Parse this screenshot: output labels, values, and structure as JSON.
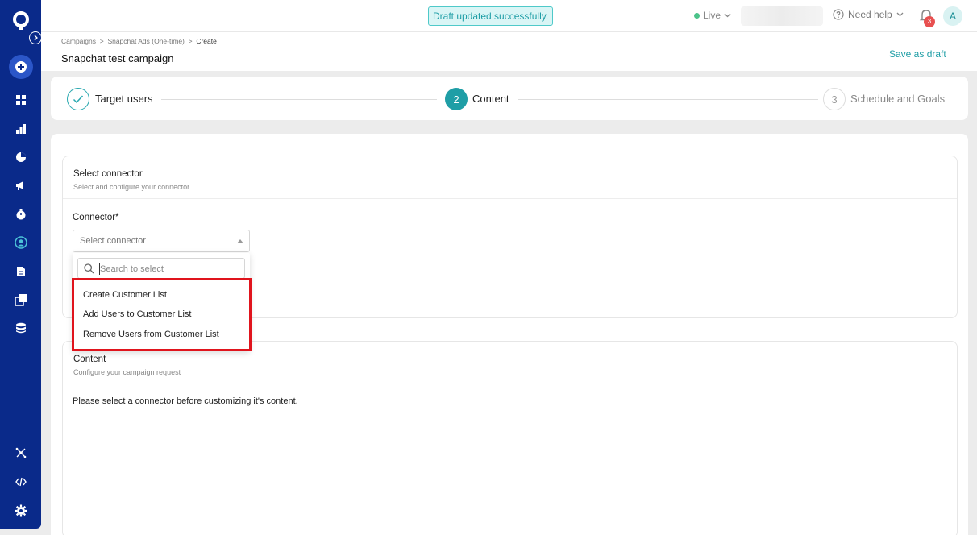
{
  "topbar": {
    "toast": "Draft updated successfully.",
    "env_label": "Live",
    "help_label": "Need help",
    "notification_count": "3",
    "avatar_initial": "A"
  },
  "header": {
    "breadcrumb": {
      "items": [
        "Campaigns",
        "Snapchat Ads (One-time)"
      ],
      "current": "Create"
    },
    "title": "Snapchat test campaign",
    "save_draft": "Save as draft"
  },
  "stepper": {
    "steps": [
      {
        "number": "",
        "label": "Target users",
        "state": "done"
      },
      {
        "number": "2",
        "label": "Content",
        "state": "active"
      },
      {
        "number": "3",
        "label": "Schedule and Goals",
        "state": "pending"
      }
    ]
  },
  "connector_card": {
    "title": "Select connector",
    "subtitle": "Select and configure your connector",
    "field_label": "Connector*",
    "select_placeholder": "Select connector",
    "search_placeholder": "Search to select",
    "options": [
      "Create Customer List",
      "Add Users to Customer List",
      "Remove Users from Customer List"
    ]
  },
  "content_card": {
    "title": "Content",
    "subtitle": "Configure your campaign request",
    "message": "Please select a connector before customizing it's content."
  },
  "colors": {
    "sidebar": "#0a2a8a",
    "accent": "#1f9ea6",
    "highlight": "#e0141d"
  }
}
